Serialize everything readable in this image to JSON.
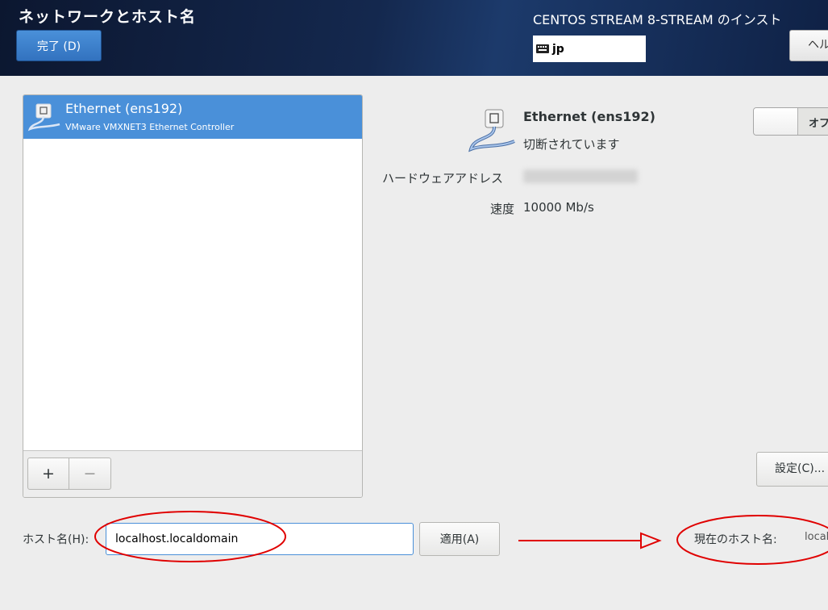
{
  "header": {
    "title": "ネットワークとホスト名",
    "done_label": "完了 (D)",
    "product": "CENTOS STREAM 8-STREAM のインスト",
    "keyboard_layout": "jp",
    "help_label": "ヘル"
  },
  "device_list": {
    "items": [
      {
        "name": "Ethernet (ens192)",
        "description": "VMware VMXNET3 Ethernet Controller",
        "selected": true
      }
    ],
    "add_label": "+",
    "remove_label": "−"
  },
  "device_detail": {
    "name": "Ethernet (ens192)",
    "status": "切断されています",
    "hardware_address_label": "ハードウェアアドレス",
    "speed_label": "速度",
    "speed_value": "10000 Mb/s",
    "toggle_label": "オフ",
    "toggle_on": false,
    "configure_label": "設定(C)..."
  },
  "hostname": {
    "label": "ホスト名(H):",
    "value": "localhost.localdomain",
    "apply_label": "適用(A)",
    "current_label": "現在のホスト名:",
    "current_value": "localhost"
  },
  "colors": {
    "accent": "#4a90d9",
    "header_bg": "#14284e",
    "annotation": "#e00000"
  }
}
